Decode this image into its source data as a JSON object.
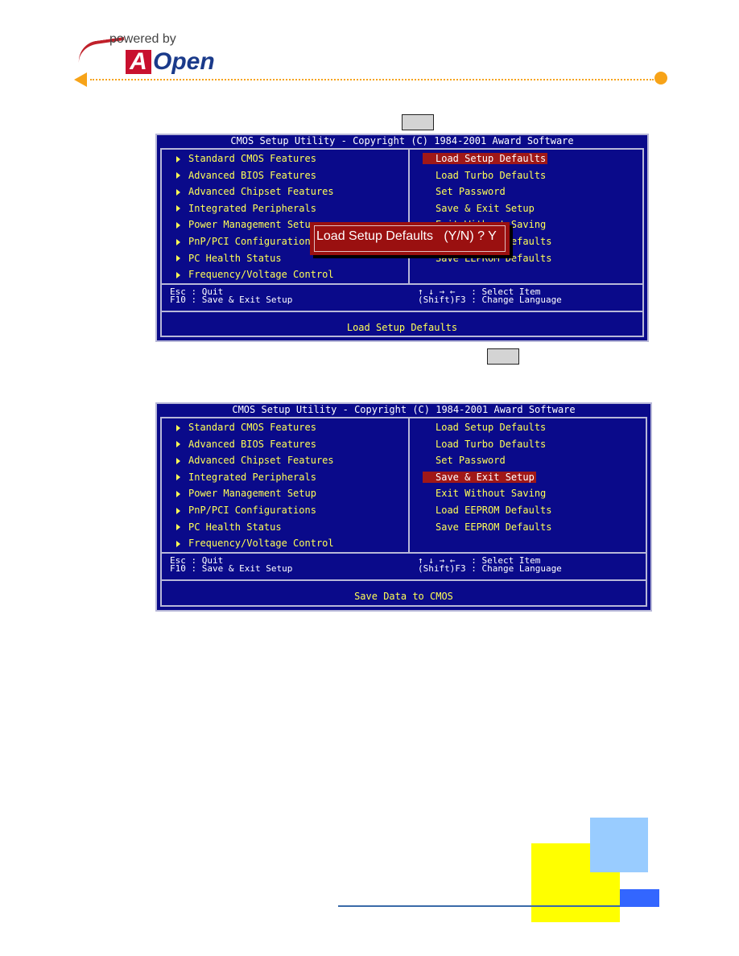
{
  "header": {
    "powered_by": "powered by",
    "brand_a": "A",
    "brand_rest": "Open",
    "accent_color": "#f7a318"
  },
  "screens": [
    {
      "title": "CMOS Setup Utility - Copyright (C) 1984-2001 Award Software",
      "left_menu": [
        "Standard CMOS Features",
        "Advanced BIOS Features",
        "Advanced Chipset Features",
        "Integrated Peripherals",
        "Power Management Setup",
        "PnP/PCI Configurations",
        "PC Health Status",
        "Frequency/Voltage Control"
      ],
      "right_menu": [
        "Load Setup Defaults",
        "Load Turbo Defaults",
        "Set Password",
        "Save & Exit Setup",
        "Exit Without Saving",
        "Load EEPROM Defaults",
        "Save EEPROM Defaults"
      ],
      "selected_right_index": 0,
      "help_left_1": "Esc : Quit",
      "help_left_2": "F10 : Save & Exit Setup",
      "help_right_1": "↑ ↓ → ←   : Select Item",
      "help_right_2": "(Shift)F3 : Change Language",
      "status": "Load Setup Defaults",
      "dialog": "Load Setup Defaults   (Y/N) ? Y"
    },
    {
      "title": "CMOS Setup Utility - Copyright (C) 1984-2001 Award Software",
      "left_menu": [
        "Standard CMOS Features",
        "Advanced BIOS Features",
        "Advanced Chipset Features",
        "Integrated Peripherals",
        "Power Management Setup",
        "PnP/PCI Configurations",
        "PC Health Status",
        "Frequency/Voltage Control"
      ],
      "right_menu": [
        "Load Setup Defaults",
        "Load Turbo Defaults",
        "Set Password",
        "Save & Exit Setup",
        "Exit Without Saving",
        "Load EEPROM Defaults",
        "Save EEPROM Defaults"
      ],
      "selected_right_index": 3,
      "help_left_1": "Esc : Quit",
      "help_left_2": "F10 : Save & Exit Setup",
      "help_right_1": "↑ ↓ → ←   : Select Item",
      "help_right_2": "(Shift)F3 : Change Language",
      "status": "Save Data to CMOS"
    }
  ],
  "colors": {
    "bios_bg": "#0a0a8a",
    "bios_text": "#ffff55",
    "highlight": "#a01818"
  }
}
